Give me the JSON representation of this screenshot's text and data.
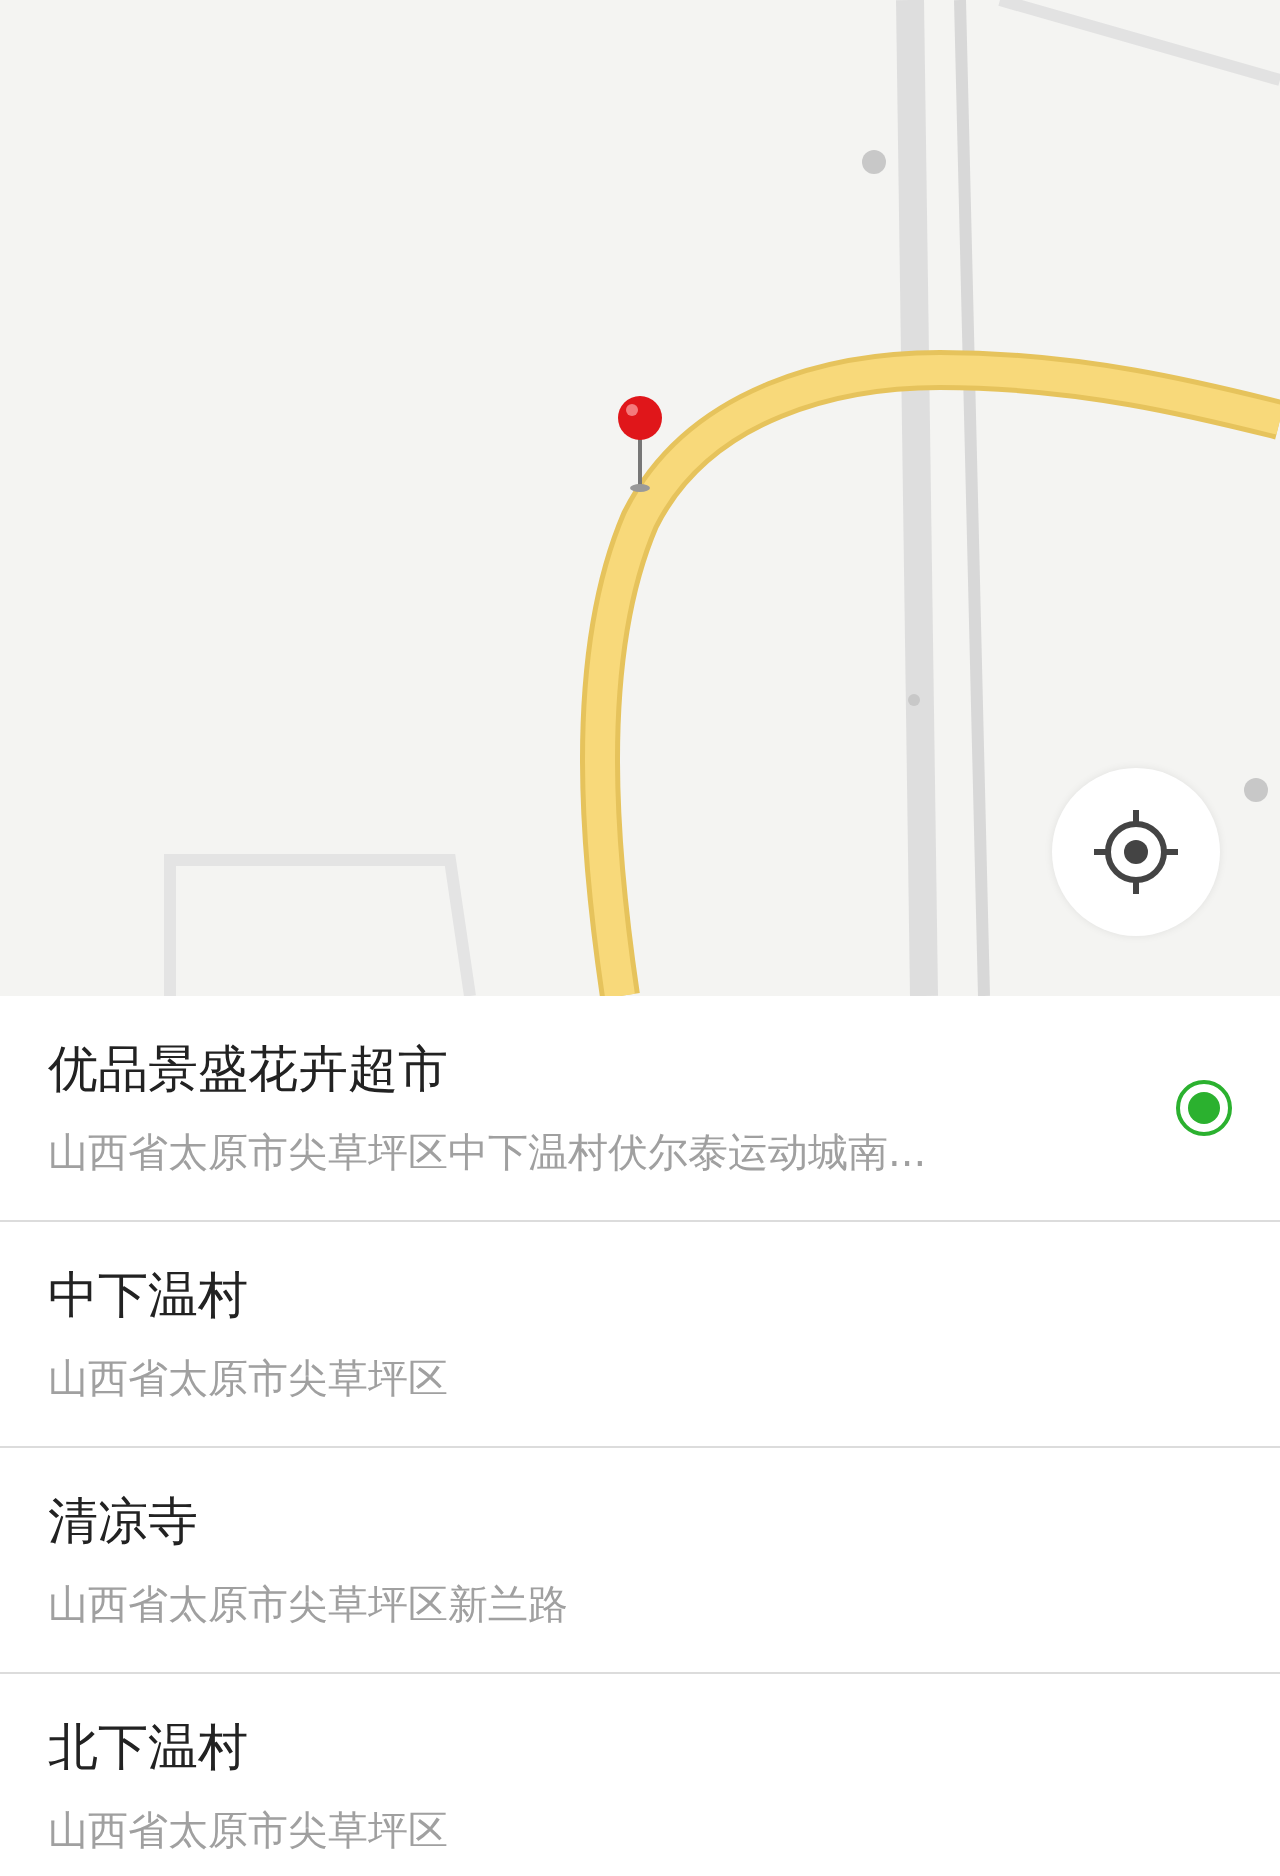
{
  "places": [
    {
      "name": "优品景盛花卉超市",
      "address": "山西省太原市尖草坪区中下温村伏尔泰运动城南...",
      "selected": true
    },
    {
      "name": "中下温村",
      "address": "山西省太原市尖草坪区",
      "selected": false
    },
    {
      "name": "清凉寺",
      "address": "山西省太原市尖草坪区新兰路",
      "selected": false
    },
    {
      "name": "北下温村",
      "address": "山西省太原市尖草坪区",
      "selected": false
    }
  ]
}
